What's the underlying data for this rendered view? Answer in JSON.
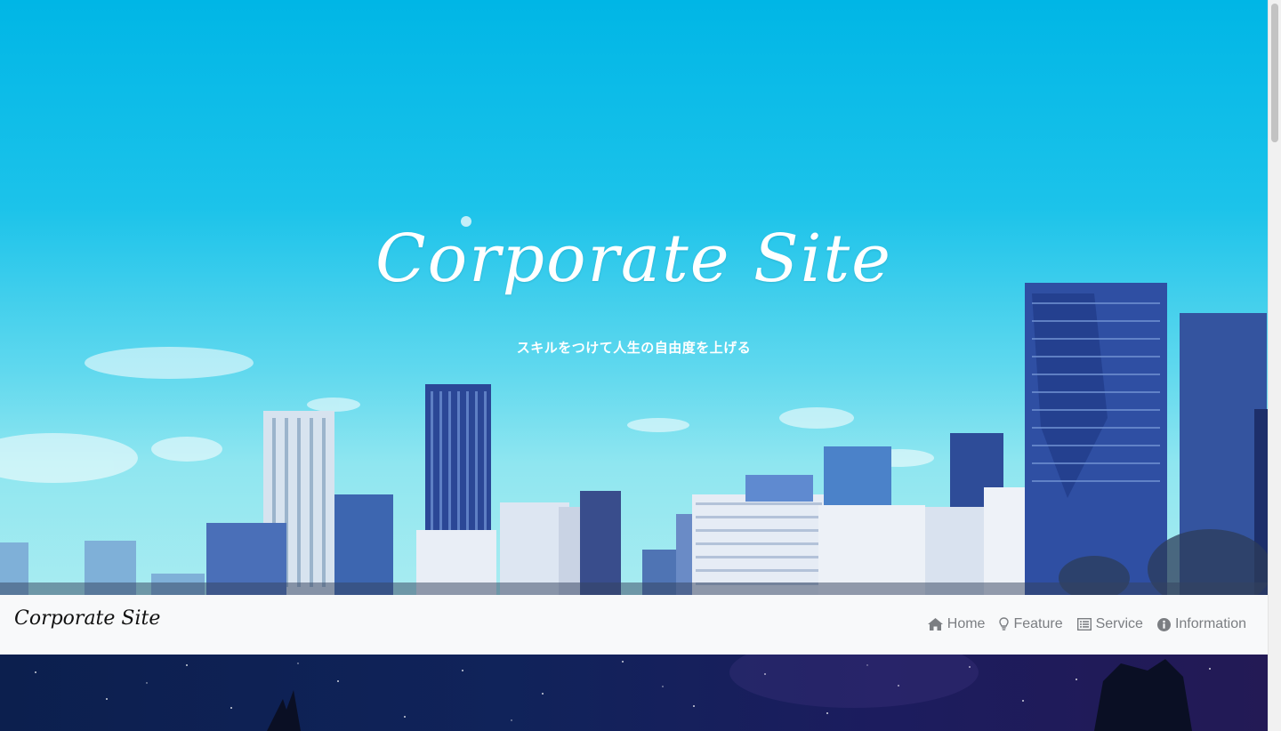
{
  "hero": {
    "title": "Corporate Site",
    "subtitle": "スキルをつけて人生の自由度を上げる"
  },
  "navbar": {
    "brand": "Corporate Site",
    "items": [
      {
        "label": "Home",
        "icon": "home-icon"
      },
      {
        "label": "Feature",
        "icon": "lightbulb-icon"
      },
      {
        "label": "Service",
        "icon": "list-icon"
      },
      {
        "label": "Information",
        "icon": "info-circle-icon"
      }
    ]
  },
  "colors": {
    "sky": "#00b6e6",
    "navbar_bg": "#f8f9fa",
    "nav_text": "#7b7e82",
    "night": "#10235a"
  }
}
